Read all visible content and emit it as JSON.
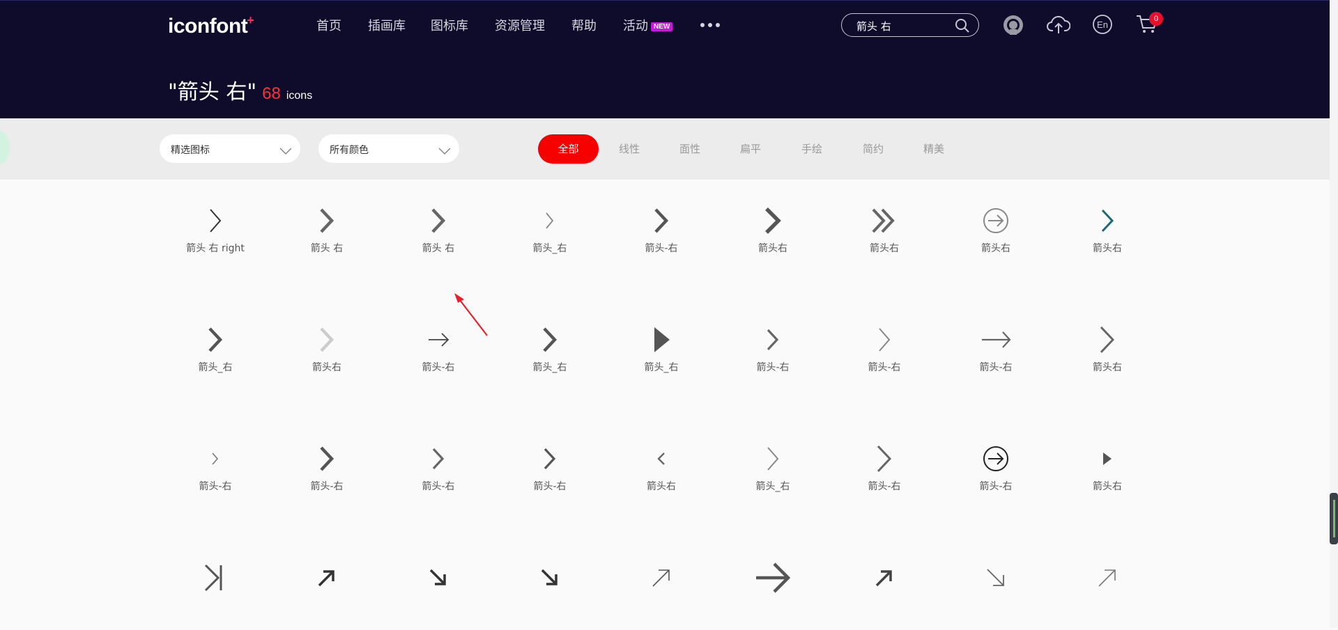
{
  "header": {
    "logo": "iconfont",
    "logo_plus": "+",
    "nav": [
      {
        "label": "首页"
      },
      {
        "label": "插画库"
      },
      {
        "label": "图标库"
      },
      {
        "label": "资源管理"
      },
      {
        "label": "帮助"
      },
      {
        "label": "活动",
        "badge": "NEW"
      }
    ],
    "search": {
      "value": "箭头 右",
      "icon": "search-icon"
    },
    "icons": [
      "user-avatar-icon",
      "cloud-upload-icon",
      "language-en-icon",
      "cart-icon"
    ],
    "language_label": "En",
    "cart_count": "0"
  },
  "result": {
    "query": "\"箭头 右\"",
    "count": "68",
    "unit": "icons"
  },
  "filters": {
    "category_select": "精选图标",
    "color_select": "所有颜色",
    "tabs": [
      "全部",
      "线性",
      "面性",
      "扁平",
      "手绘",
      "简约",
      "精美"
    ],
    "active_tab": "全部"
  },
  "icons": [
    {
      "name": "箭头 右 right",
      "shape": "chevron-thin",
      "color": "#333333"
    },
    {
      "name": "箭头 右",
      "shape": "chevron-bold",
      "color": "#666666"
    },
    {
      "name": "箭头 右",
      "shape": "chevron-bold",
      "color": "#666666"
    },
    {
      "name": "箭头_右",
      "shape": "chevron-small",
      "color": "#888888"
    },
    {
      "name": "箭头-右",
      "shape": "chevron-bold",
      "color": "#555555"
    },
    {
      "name": "箭头右",
      "shape": "chevron-heavy",
      "color": "#555555"
    },
    {
      "name": "箭头右",
      "shape": "double-chevron",
      "color": "#666666"
    },
    {
      "name": "箭头右",
      "shape": "circle-arrow",
      "color": "#888888"
    },
    {
      "name": "箭头右",
      "shape": "chevron-teal",
      "color": "#1a6a76"
    },
    {
      "name": "箭头_右",
      "shape": "chevron-bold",
      "color": "#555555"
    },
    {
      "name": "箭头右",
      "shape": "chevron-bold",
      "color": "#cccccc"
    },
    {
      "name": "箭头-右",
      "shape": "arrow-thin",
      "color": "#444444"
    },
    {
      "name": "箭头_右",
      "shape": "chevron-bold",
      "color": "#555555"
    },
    {
      "name": "箭头_右",
      "shape": "triangle",
      "color": "#555555"
    },
    {
      "name": "箭头-右",
      "shape": "chevron-medium",
      "color": "#666666"
    },
    {
      "name": "箭头-右",
      "shape": "chevron-thin",
      "color": "#888888"
    },
    {
      "name": "箭头-右",
      "shape": "arrow-long",
      "color": "#666666"
    },
    {
      "name": "箭头右",
      "shape": "chevron-tall",
      "color": "#666666"
    },
    {
      "name": "箭头-右",
      "shape": "chevron-tiny",
      "color": "#777777"
    },
    {
      "name": "箭头-右",
      "shape": "chevron-bold",
      "color": "#555555"
    },
    {
      "name": "箭头-右",
      "shape": "chevron-medium",
      "color": "#666666"
    },
    {
      "name": "箭头-右",
      "shape": "chevron-medium",
      "color": "#555555"
    },
    {
      "name": "箭头右",
      "shape": "chevron-left",
      "color": "#666666"
    },
    {
      "name": "箭头_右",
      "shape": "chevron-thin",
      "color": "#888888"
    },
    {
      "name": "箭头-右",
      "shape": "chevron-tall",
      "color": "#666666"
    },
    {
      "name": "箭头-右",
      "shape": "circle-arrow",
      "color": "#222222"
    },
    {
      "name": "箭头右",
      "shape": "triangle-small",
      "color": "#555555"
    },
    {
      "name": "",
      "shape": "chevron-bar",
      "color": "#555555"
    },
    {
      "name": "",
      "shape": "arrow-ne-bold",
      "color": "#333333"
    },
    {
      "name": "",
      "shape": "arrow-se-bold",
      "color": "#333333"
    },
    {
      "name": "",
      "shape": "arrow-se-bold",
      "color": "#333333"
    },
    {
      "name": "",
      "shape": "arrow-ne-thin",
      "color": "#555555"
    },
    {
      "name": "",
      "shape": "arrow-right-heavy",
      "color": "#555555"
    },
    {
      "name": "",
      "shape": "arrow-ne-bold",
      "color": "#444444"
    },
    {
      "name": "",
      "shape": "arrow-se-thin",
      "color": "#666666"
    },
    {
      "name": "",
      "shape": "arrow-ne-thin",
      "color": "#777777"
    }
  ]
}
